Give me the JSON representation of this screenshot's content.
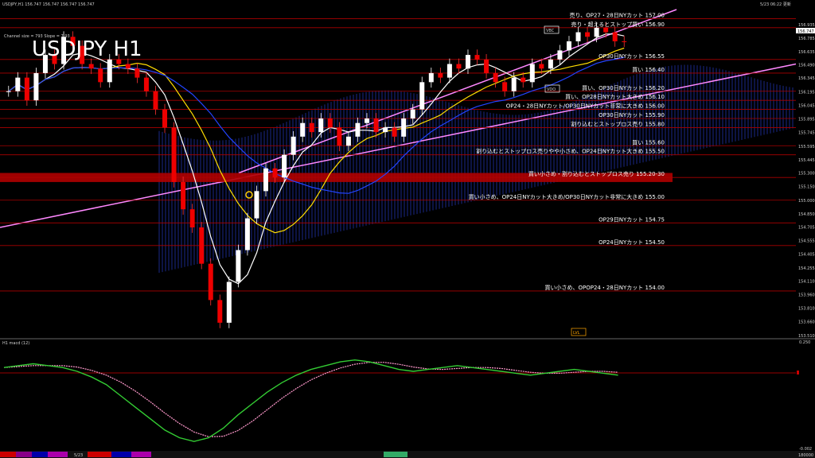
{
  "header": {
    "symbol_info": "USDJPY,H1  156.747 156.747 156.747 156.747",
    "datetime": "5/23 06:22 更新"
  },
  "overlay": {
    "title": "USDJPY H1",
    "channel_info": "Channel size = 793 Slope = 7.93",
    "box_labels": [
      "VBC",
      "VDO",
      "LVL"
    ]
  },
  "macd": {
    "label": "H1  macd (12)",
    "top_tick": "0.250",
    "bottom_tick": "-0.002"
  },
  "footer": {
    "date_label": "5/23",
    "right_label": "180000"
  },
  "chart_data": {
    "type": "candlestick",
    "symbol": "USDJPY",
    "timeframe": "H1",
    "ylim": [
      153.5,
      157.1
    ],
    "y_ticks": [
      156.935,
      156.785,
      156.635,
      156.49,
      156.345,
      156.195,
      156.045,
      155.895,
      155.745,
      155.595,
      155.445,
      155.3,
      155.15,
      155.0,
      154.85,
      154.705,
      154.555,
      154.405,
      154.255,
      154.11,
      153.96,
      153.81,
      153.66,
      153.51
    ],
    "current_price": 156.747,
    "close_series": [
      156.2,
      156.35,
      156.1,
      156.4,
      156.6,
      156.5,
      156.8,
      156.7,
      156.5,
      156.45,
      156.3,
      156.55,
      156.5,
      156.45,
      156.35,
      156.2,
      156.0,
      155.8,
      155.2,
      154.9,
      154.7,
      154.3,
      153.9,
      153.65,
      154.1,
      154.45,
      154.8,
      155.1,
      155.35,
      155.25,
      155.5,
      155.7,
      155.85,
      155.75,
      155.9,
      155.8,
      155.6,
      155.7,
      155.85,
      155.9,
      155.75,
      155.8,
      155.7,
      155.9,
      156.0,
      156.3,
      156.4,
      156.35,
      156.5,
      156.45,
      156.6,
      156.55,
      156.4,
      156.3,
      156.2,
      156.35,
      156.3,
      156.5,
      156.45,
      156.55,
      156.65,
      156.75,
      156.85,
      156.8,
      156.9,
      156.85,
      156.75,
      156.747
    ],
    "levels": [
      {
        "price": 157.0,
        "label": "売り、OP27・28日NYカット 157.00"
      },
      {
        "price": 156.9,
        "label": "売り・超えるとストップ買い 156.90"
      },
      {
        "price": 156.55,
        "label": "OP30日NYカット 156.55"
      },
      {
        "price": 156.4,
        "label": "買い 156.40"
      },
      {
        "price": 156.2,
        "label": "買い、OP30日NYカット 156.20"
      },
      {
        "price": 156.1,
        "label": "買い、OP28日NYカット大きめ 156.10"
      },
      {
        "price": 156.0,
        "label": "OP24・28日NYカット/OP30日NYカット非常に大きめ 156.00"
      },
      {
        "price": 155.9,
        "label": "OP30日NYカット 155.90"
      },
      {
        "price": 155.8,
        "label": "割り込むとストップロス売り 155.80"
      },
      {
        "price": 155.6,
        "label": "買い 155.60"
      },
      {
        "price": 155.5,
        "label": "割り込むとストップロス売りやや小さめ、OP24日NYカット大きめ 155.50"
      },
      {
        "price": 155.25,
        "label": "買い小さめ・割り込むとストップロス売り 155.20-30"
      },
      {
        "price": 155.0,
        "label": "買い小さめ、OP24日NYカット大きめ/OP30日NYカット非常に大きめ 155.00"
      },
      {
        "price": 154.75,
        "label": "OP29日NYカット 154.75"
      },
      {
        "price": 154.5,
        "label": "OP24日NYカット 154.50"
      },
      {
        "price": 154.0,
        "label": "買い小さめ、OPOP24・28日NYカット 154.00"
      }
    ],
    "macd_values": [
      0.15,
      0.16,
      0.17,
      0.16,
      0.15,
      0.13,
      0.1,
      0.06,
      0.0,
      -0.06,
      -0.12,
      -0.18,
      -0.22,
      -0.24,
      -0.22,
      -0.17,
      -0.1,
      -0.04,
      0.02,
      0.07,
      0.11,
      0.14,
      0.16,
      0.18,
      0.19,
      0.18,
      0.16,
      0.14,
      0.13,
      0.14,
      0.15,
      0.16,
      0.15,
      0.14,
      0.13,
      0.12,
      0.11,
      0.12,
      0.13,
      0.14,
      0.13,
      0.12,
      0.11
    ]
  }
}
